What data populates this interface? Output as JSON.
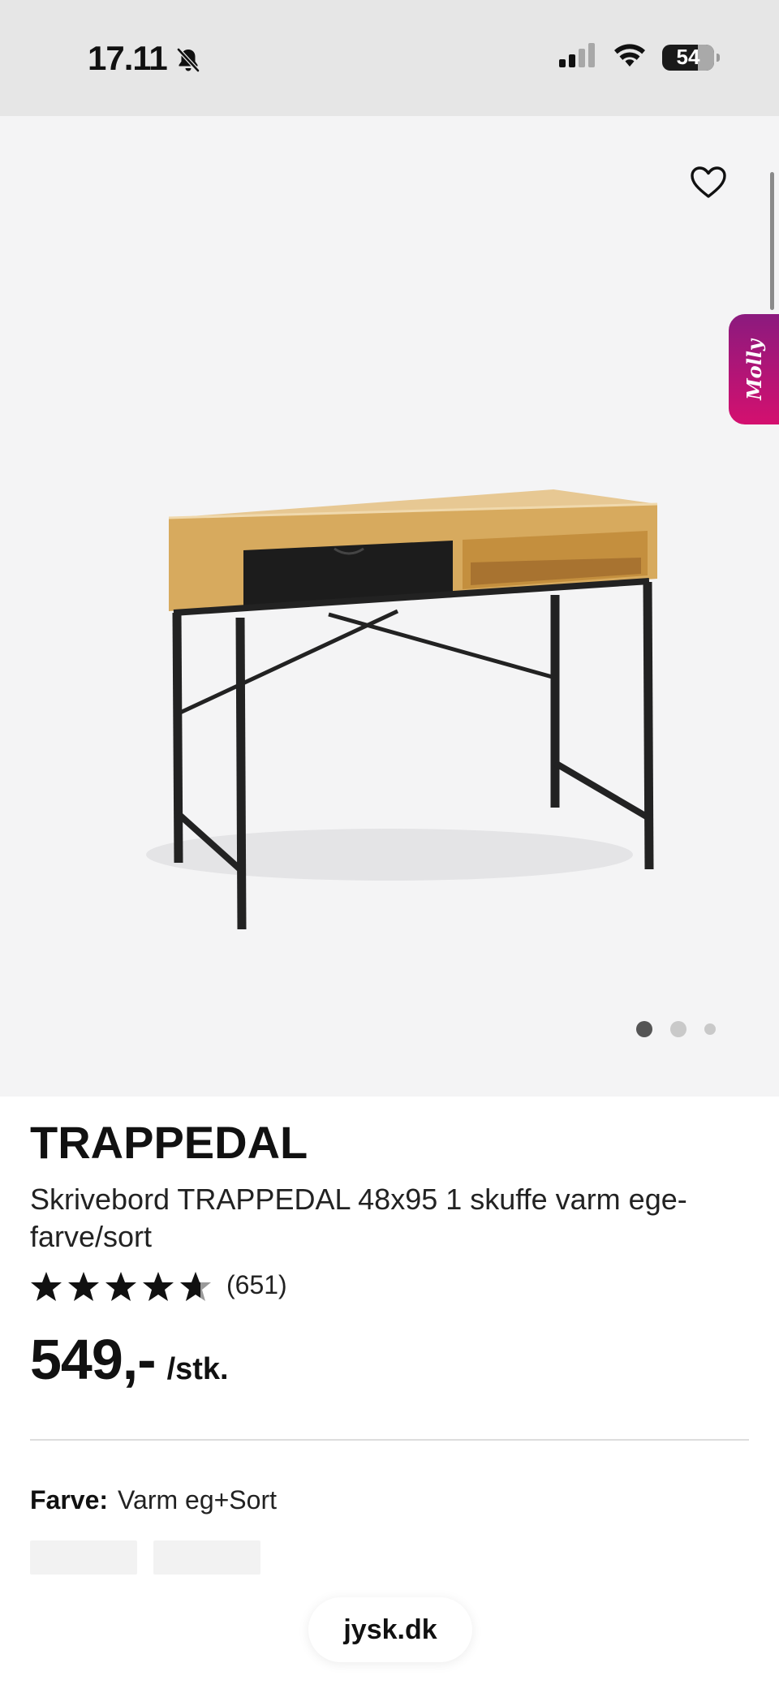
{
  "status_bar": {
    "time": "17.11",
    "battery": "54",
    "silent_icon": "bell-slash-icon",
    "signal_icon": "cellular-signal-icon",
    "wifi_icon": "wifi-icon"
  },
  "gallery": {
    "image_alt": "Skrivebord TRAPPEDAL",
    "favorite_icon": "heart-icon",
    "chat_widget_label": "Molly",
    "pagination": {
      "total": 3,
      "active_index": 0
    }
  },
  "product": {
    "brand": "TRAPPEDAL",
    "name": "Skrivebord TRAPPEDAL 48x95 1 skuffe varm ege-farve/sort",
    "rating": {
      "stars": 4.5,
      "max": 5,
      "count": "(651)"
    },
    "price": "549,-",
    "price_unit": "/stk."
  },
  "options": {
    "color_label": "Farve:",
    "color_value": "Varm eg+Sort"
  },
  "browser": {
    "url": "jysk.dk"
  },
  "colors": {
    "status_bar_bg": "#e6e6e6",
    "gallery_bg": "#f4f4f5",
    "molly_gradient_start": "#8b1a7e",
    "molly_gradient_end": "#d4106f"
  }
}
